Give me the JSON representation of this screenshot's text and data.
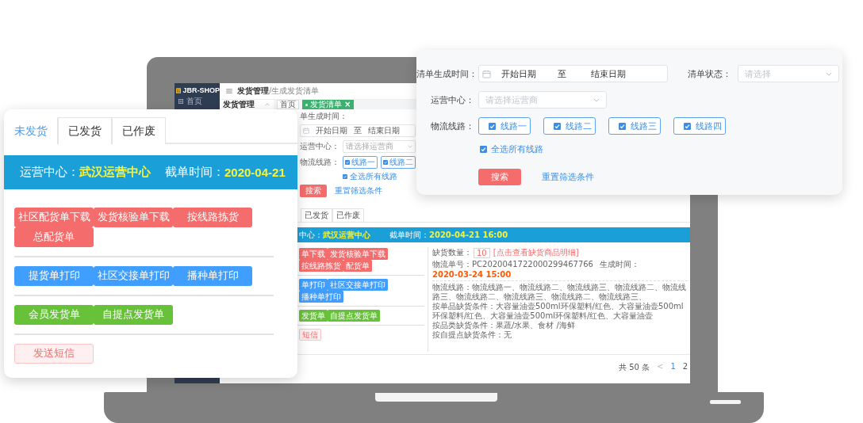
{
  "laptop_screen": {
    "app_name": "JBR-SHOP",
    "sidebar_items": [
      {
        "label": "首页",
        "selected": false
      }
    ],
    "breadcrumb": {
      "section": "发货管理",
      "page": "/生成发货清单"
    },
    "menu_group": {
      "label": "发货管理",
      "expanded": true
    },
    "page_tabs": [
      {
        "label": "首页",
        "selected": false
      },
      {
        "label": "发货清单",
        "selected": true,
        "close": "×"
      }
    ],
    "filter": {
      "date_label": "单生成时间：",
      "date_start": "开始日期",
      "date_sep": "至",
      "date_end": "结束日期",
      "center_label": "运营中心：",
      "center_placeholder": "请选择运营商",
      "routes_label": "物流线路：",
      "routes": [
        {
          "label": "线路一",
          "checked": true
        },
        {
          "label": "线路二",
          "checked": true
        }
      ],
      "select_all": {
        "label": "全选所有线路",
        "checked": true
      },
      "search_button": "搜索",
      "reset_link": "重置筛选条件"
    },
    "status_tabs": [
      {
        "label": "已发货",
        "selected": false
      },
      {
        "label": "已作废",
        "selected": false
      }
    ],
    "banner": {
      "center_label": "中心：",
      "center_value": "武汉运营中心",
      "cutoff_label": "截单时间：",
      "cutoff_value": "2020-04-21 16:00"
    },
    "action_groups": [
      [
        {
          "label": "单下载",
          "kind": "danger"
        },
        {
          "label": "发货核验单下载",
          "kind": "danger"
        },
        {
          "label": "按线路拣货",
          "kind": "danger"
        },
        {
          "label": "配货单",
          "kind": "danger"
        }
      ],
      [
        {
          "label": "单打印",
          "kind": "primary"
        },
        {
          "label": "社区交接单打印",
          "kind": "primary"
        },
        {
          "label": "播种单打印",
          "kind": "primary"
        }
      ],
      [
        {
          "label": "发货单",
          "kind": "success"
        },
        {
          "label": "自提点发货单",
          "kind": "success"
        }
      ],
      [
        {
          "label": "短信",
          "kind": "plain"
        }
      ]
    ],
    "details": {
      "shortage_label": "缺货数量：",
      "shortage_count": "10",
      "shortage_link": "[点击查看缺货商品明细]",
      "tracking": "物流单号：PC2020041722000299467766",
      "created_label": "生成时间：",
      "created_value": "2020-03-24 15:00",
      "lines": [
        "物流线路：物流线路一、物流线路二、物流线路三、物流线路二、物流线路三、物流线路二、物流线路三、物流线路二、物流线路三、",
        "按单品缺货条件：大容量油壶500ml环保塑料/红色、大容量油壶500ml环保塑料/红色、大容量油壶500ml环保塑料/红色、大容量油壶",
        "按品类缺货条件：果蔬/水果、食材 /海鲜",
        "按自提点缺货条件：无"
      ]
    },
    "pagination": {
      "total": "共 50 条",
      "prev": "<",
      "pages": [
        {
          "label": "1",
          "selected": true
        },
        {
          "label": "2",
          "selected": false
        }
      ]
    }
  },
  "order_panel": {
    "tabs": [
      {
        "label": "未发货",
        "selected": true
      },
      {
        "label": "已发货",
        "selected": false
      },
      {
        "label": "已作废",
        "selected": false
      }
    ],
    "banner": {
      "center_label": "运营中心：",
      "center_value": "武汉运营中心",
      "cutoff_label": "截单时间：",
      "cutoff_value": "2020-04-21"
    },
    "action_groups": [
      [
        {
          "label": "社区配货单下载",
          "kind": "danger"
        },
        {
          "label": "发货核验单下载",
          "kind": "danger"
        },
        {
          "label": "按线路拣货",
          "kind": "danger"
        },
        {
          "label": "总配货单",
          "kind": "danger"
        }
      ],
      [
        {
          "label": "提货单打印",
          "kind": "primary"
        },
        {
          "label": "社区交接单打印",
          "kind": "primary"
        },
        {
          "label": "播种单打印",
          "kind": "primary"
        }
      ],
      [
        {
          "label": "会员发货单",
          "kind": "success"
        },
        {
          "label": "自提点发货单",
          "kind": "success"
        }
      ],
      [
        {
          "label": "发送短信",
          "kind": "plain"
        }
      ]
    ]
  },
  "filter_panel": {
    "date_label": "清单生成时间：",
    "date_start": "开始日期",
    "date_sep": "至",
    "date_end": "结束日期",
    "status_label": "清单状态：",
    "status_placeholder": "请选择",
    "center_label": "运营中心：",
    "center_placeholder": "请选择运营商",
    "routes_label": "物流线路：",
    "routes": [
      {
        "label": "线路一",
        "checked": true
      },
      {
        "label": "线路二",
        "checked": true
      },
      {
        "label": "线路三",
        "checked": true
      },
      {
        "label": "线路四",
        "checked": true
      }
    ],
    "select_all": {
      "label": "全选所有线路",
      "checked": true
    },
    "search_button": "搜索",
    "reset_link": "重置筛选条件"
  }
}
